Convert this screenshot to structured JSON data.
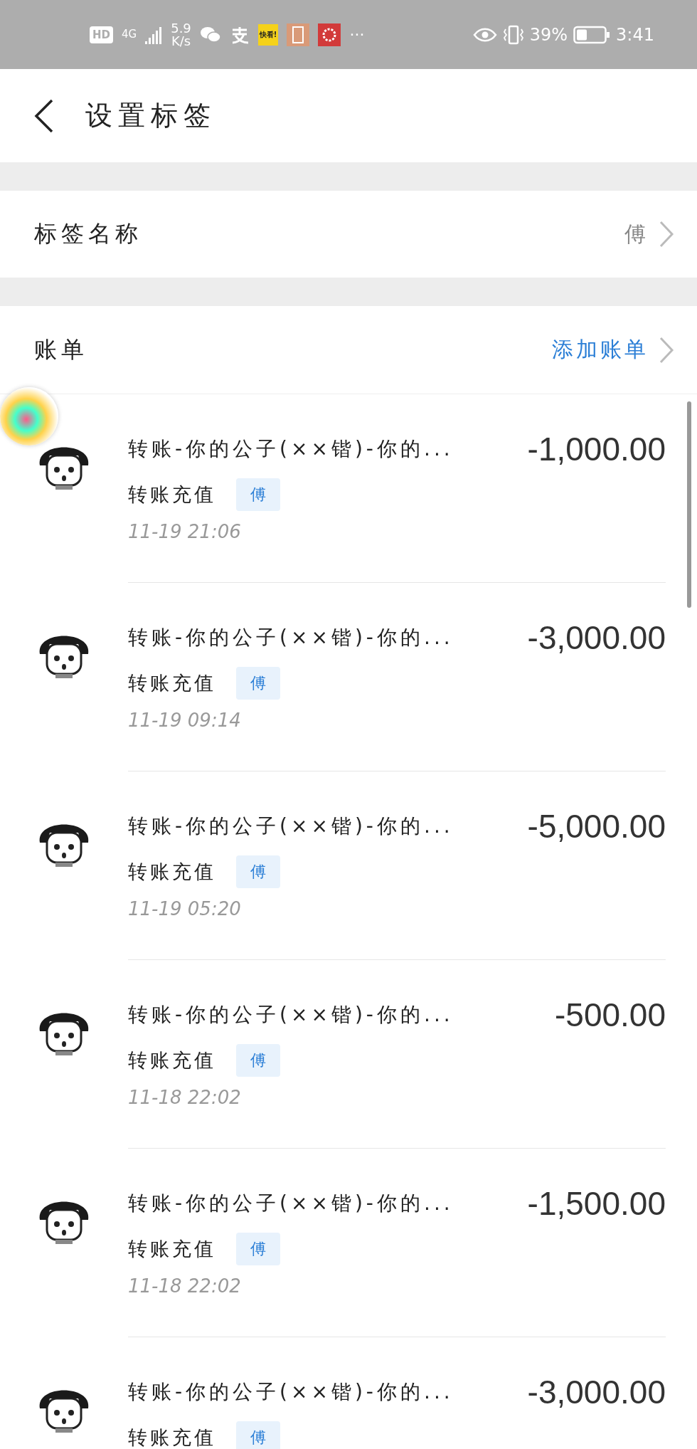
{
  "status_bar": {
    "hd": "HD",
    "network": "4G",
    "speed_value": "5.9",
    "speed_unit": "K/s",
    "app_badge": "快看!",
    "more": "···",
    "battery_percent": "39%",
    "time": "3:41"
  },
  "header": {
    "title": "设置标签"
  },
  "tag_name": {
    "label": "标签名称",
    "value": "傅"
  },
  "bills": {
    "label": "账单",
    "action": "添加账单",
    "items": [
      {
        "title": "转账-你的公子(××锴)-你的...",
        "category": "转账充值",
        "tag": "傅",
        "time": "11-19  21:06",
        "amount": "-1,000.00"
      },
      {
        "title": "转账-你的公子(××锴)-你的...",
        "category": "转账充值",
        "tag": "傅",
        "time": "11-19  09:14",
        "amount": "-3,000.00"
      },
      {
        "title": "转账-你的公子(××锴)-你的...",
        "category": "转账充值",
        "tag": "傅",
        "time": "11-19  05:20",
        "amount": "-5,000.00"
      },
      {
        "title": "转账-你的公子(××锴)-你的...",
        "category": "转账充值",
        "tag": "傅",
        "time": "11-18  22:02",
        "amount": "-500.00"
      },
      {
        "title": "转账-你的公子(××锴)-你的...",
        "category": "转账充值",
        "tag": "傅",
        "time": "11-18  22:02",
        "amount": "-1,500.00"
      },
      {
        "title": "转账-你的公子(××锴)-你的...",
        "category": "转账充值",
        "tag": "傅",
        "amount": "-3,000.00"
      }
    ]
  }
}
